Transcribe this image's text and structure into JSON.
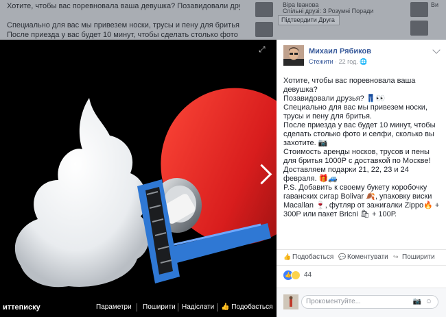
{
  "background": {
    "line1": "Хотите, чтобы вас поревновала ваша девушка? Позавидовали друзья?",
    "line2": "Специально для вас мы привезем носки, трусы и пену для бритья.",
    "line3": "После приезда у вас будет 10 минут, чтобы сделать столько фото и селфи, сколько вы",
    "side1": "Віра Іванова",
    "side2": "Спільні друзі: 3 Розумні Поради",
    "side_button": "Підтвердити Друга",
    "side3": "Ви"
  },
  "photo": {
    "caption": "иттеписку",
    "actions": [
      "Параметри",
      "Поширити",
      "Надіслати",
      "Подобається"
    ]
  },
  "post": {
    "author": "Михаил Рябиков",
    "follow": "Стежити",
    "time": "22 год.",
    "lines": [
      "Хотите, чтобы вас поревновала ваша девушка?",
      "Позавидовали друзья? 👖👀",
      "Специально для вас мы привезем носки, трусы и пену для бритья.",
      "После приезда у вас будет 10 минут, чтобы сделать столько фото и селфи, сколько вы захотите. 📷",
      "Стоимость аренды носков, трусов и пены для бритья 1000Р с доставкой по Москве!",
      "Доставляем подарки 21, 22, 23 и 24 февраля. 🎁🚙",
      "P.S. Добавить к своему букету коробочку гаванских сигар Bolivar 🍂, упаковку виски Macallan 🍷, футляр от зажигалки Zippo🔥 + 300Р или пакет Bricni 🛍 + 100Р."
    ],
    "actions": {
      "like": "Подобається",
      "comment": "Коментувати",
      "share": "Поширити"
    },
    "reaction_count": "44",
    "comment_placeholder": "Прокоментуйте..."
  },
  "icons": {
    "expand": "expand-icon",
    "next": "chevron-right-icon",
    "camera": "camera-icon",
    "smiley": "smiley-icon"
  },
  "colors": {
    "link": "#365899",
    "like": "#4080ff",
    "text": "#1d2129",
    "razor": "#2f78d4",
    "can": "#d81d1d"
  }
}
